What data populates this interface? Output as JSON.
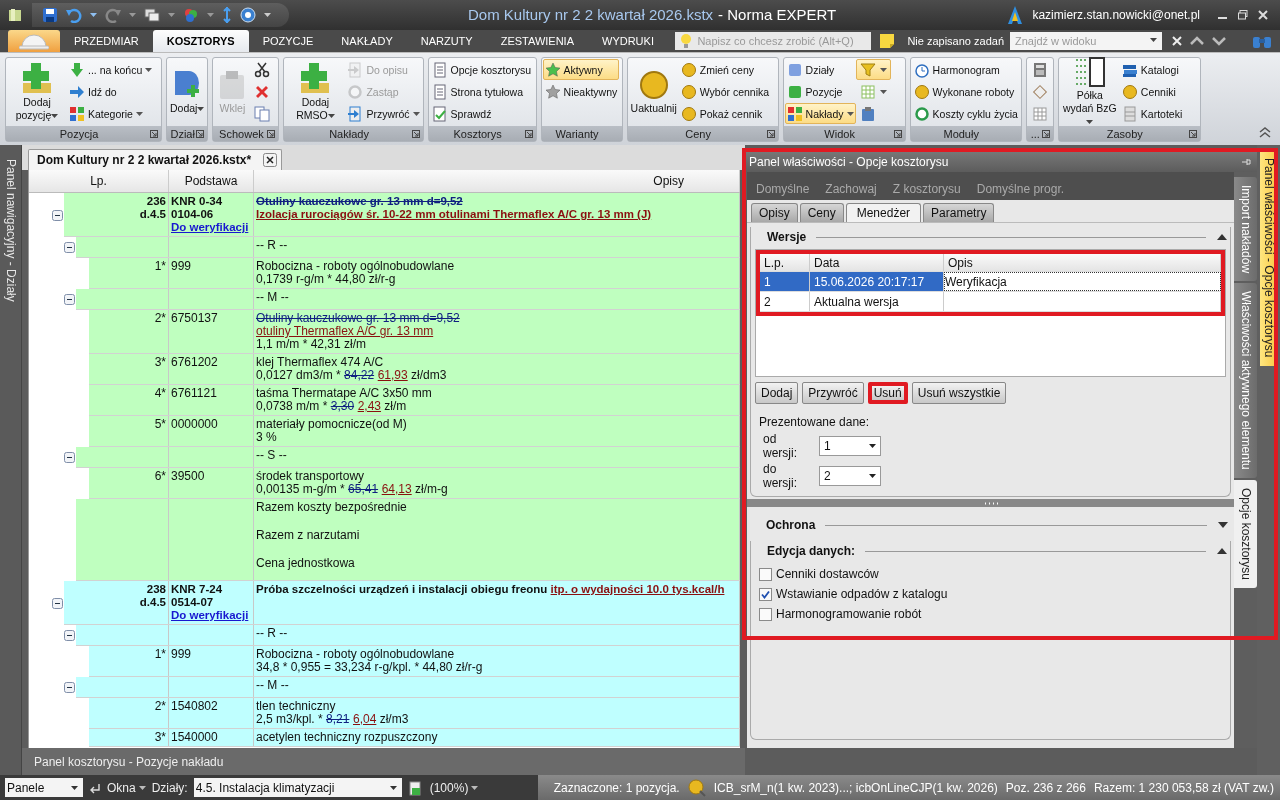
{
  "window": {
    "document": "Dom Kultury nr 2 2 kwartał 2026.kstx",
    "app": "- Norma EXPERT",
    "user": "kazimierz.stan.nowicki@onet.pl"
  },
  "ribbon_tabs": [
    {
      "label": "PRZEDMIAR",
      "selected": false
    },
    {
      "label": "KOSZTORYS",
      "selected": true
    },
    {
      "label": "POZYCJE",
      "selected": false
    },
    {
      "label": "NAKŁADY",
      "selected": false
    },
    {
      "label": "NARZUTY",
      "selected": false
    },
    {
      "label": "ZESTAWIENIA",
      "selected": false
    },
    {
      "label": "WYDRUKI",
      "selected": false
    }
  ],
  "help_field": {
    "placeholder": "Napisz co chcesz zrobić (Alt+Q)"
  },
  "tasks_label": "Nie zapisano zadań",
  "find_field": {
    "placeholder": "Znajdź w widoku"
  },
  "ribbon_groups": [
    {
      "label": "Pozycja",
      "launcher": true,
      "items": [
        {
          "kind": "large",
          "label": "Dodaj pozycję",
          "dropdown": true,
          "disabled": false,
          "selected": false
        },
        {
          "kind": "small",
          "label": "... na końcu",
          "dropdown": true,
          "disabled": false,
          "selected": false
        },
        {
          "kind": "small",
          "label": "Idź do",
          "dropdown": false,
          "disabled": false,
          "selected": false
        },
        {
          "kind": "small",
          "label": "Kategorie",
          "dropdown": true,
          "disabled": false,
          "selected": false
        }
      ]
    },
    {
      "label": "Dział",
      "launcher": true,
      "items": [
        {
          "kind": "large",
          "label": "Dodaj",
          "dropdown": true,
          "disabled": false,
          "selected": false
        }
      ]
    },
    {
      "label": "Schowek",
      "launcher": true,
      "items": [
        {
          "kind": "large",
          "label": "Wklej",
          "dropdown": false,
          "disabled": true,
          "selected": false
        },
        {
          "kind": "icon",
          "dropdown": false,
          "disabled": false,
          "selected": false
        },
        {
          "kind": "icon",
          "dropdown": false,
          "disabled": false,
          "selected": false
        },
        {
          "kind": "icon",
          "dropdown": false,
          "disabled": false,
          "selected": false
        }
      ]
    },
    {
      "label": "Nakłady",
      "launcher": true,
      "items": [
        {
          "kind": "large",
          "label": "Dodaj RMSO",
          "dropdown": true,
          "disabled": false,
          "selected": false
        },
        {
          "kind": "small",
          "label": "Do opisu",
          "dropdown": false,
          "disabled": true,
          "selected": false
        },
        {
          "kind": "small",
          "label": "Zastąp",
          "dropdown": false,
          "disabled": true,
          "selected": false
        },
        {
          "kind": "small",
          "label": "Przywróć",
          "dropdown": true,
          "disabled": false,
          "selected": false
        }
      ]
    },
    {
      "label": "Kosztorys",
      "launcher": true,
      "items": [
        {
          "kind": "small",
          "label": "Opcje kosztorysu",
          "dropdown": false,
          "disabled": false,
          "selected": false
        },
        {
          "kind": "small",
          "label": "Strona tytułowa",
          "dropdown": false,
          "disabled": false,
          "selected": false
        },
        {
          "kind": "small",
          "label": "Sprawdź",
          "dropdown": false,
          "disabled": false,
          "selected": false
        }
      ]
    },
    {
      "label": "Warianty",
      "launcher": false,
      "items": [
        {
          "kind": "small",
          "label": "Aktywny",
          "dropdown": false,
          "disabled": false,
          "selected": true
        },
        {
          "kind": "small",
          "label": "Nieaktywny",
          "dropdown": false,
          "disabled": false,
          "selected": false
        }
      ]
    },
    {
      "label": "Ceny",
      "launcher": true,
      "items": [
        {
          "kind": "large",
          "label": "Uaktualnij",
          "dropdown": false,
          "disabled": false,
          "selected": false
        },
        {
          "kind": "small",
          "label": "Zmień ceny",
          "dropdown": false,
          "disabled": false,
          "selected": false
        },
        {
          "kind": "small",
          "label": "Wybór cennika",
          "dropdown": false,
          "disabled": false,
          "selected": false
        },
        {
          "kind": "small",
          "label": "Pokaż cennik",
          "dropdown": false,
          "disabled": false,
          "selected": false
        }
      ]
    },
    {
      "label": "Widok",
      "launcher": true,
      "items": [
        {
          "kind": "small",
          "label": "Działy",
          "dropdown": false,
          "disabled": false,
          "selected": false
        },
        {
          "kind": "small",
          "label": "Pozycje",
          "dropdown": false,
          "disabled": false,
          "selected": false
        },
        {
          "kind": "small",
          "label": "Nakłady",
          "dropdown": true,
          "disabled": false,
          "selected": true
        },
        {
          "kind": "icon",
          "dropdown": true,
          "disabled": false,
          "selected": true
        },
        {
          "kind": "icon",
          "dropdown": true,
          "disabled": false,
          "selected": false
        },
        {
          "kind": "icon",
          "dropdown": false,
          "disabled": false,
          "selected": false
        }
      ]
    },
    {
      "label": "Moduły",
      "launcher": false,
      "items": [
        {
          "kind": "small",
          "label": "Harmonogram",
          "dropdown": false,
          "disabled": false,
          "selected": false
        },
        {
          "kind": "small",
          "label": "Wykonane roboty",
          "dropdown": false,
          "disabled": false,
          "selected": false
        },
        {
          "kind": "small",
          "label": "Koszty cyklu życia",
          "dropdown": false,
          "disabled": false,
          "selected": false
        }
      ]
    },
    {
      "label": "...",
      "launcher": true,
      "items": [
        {
          "kind": "icon",
          "dropdown": false,
          "disabled": false,
          "selected": false
        },
        {
          "kind": "icon",
          "dropdown": false,
          "disabled": false,
          "selected": false
        },
        {
          "kind": "icon",
          "dropdown": false,
          "disabled": false,
          "selected": false
        }
      ]
    },
    {
      "label": "Zasoby",
      "launcher": true,
      "items": [
        {
          "kind": "large",
          "label": "Półka wydań BzG",
          "dropdown": true,
          "disabled": false,
          "selected": false
        },
        {
          "kind": "small",
          "label": "Katalogi",
          "dropdown": false,
          "disabled": false,
          "selected": false
        },
        {
          "kind": "small",
          "label": "Cenniki",
          "dropdown": false,
          "disabled": false,
          "selected": false
        },
        {
          "kind": "small",
          "label": "Kartoteki",
          "dropdown": false,
          "disabled": false,
          "selected": false
        }
      ]
    }
  ],
  "navigation_tab": "Panel nawigacyjny - Działy",
  "document_tab": "Dom Kultury nr 2 2 kwartał 2026.kstx*",
  "table_columns": [
    "Lp.",
    "Podstawa",
    "Opisy"
  ],
  "positions": [
    {
      "lp": "236",
      "chapter": "d.4.5",
      "basis": [
        "KNR 0-34",
        "0104-06"
      ],
      "status": "Do weryfikacji",
      "color": "#bfffbf",
      "expanded": true,
      "description": [
        [
          {
            "text": "Otuliny kauczukowe gr. 13 mm d=9,52",
            "kind": "old"
          }
        ],
        [
          {
            "text": "Izolacja rurociągów śr. 10-22 mm otulinami Thermaflex A/C gr. 13 mm (J)",
            "kind": "new"
          }
        ]
      ],
      "groups": [
        {
          "label": "-- R --",
          "expanded": true,
          "resources": [
            {
              "lp": "1*",
              "code": "999",
              "lines": [
                [
                  {
                    "text": "Robocizna - roboty ogólnobudowlane",
                    "kind": "plain"
                  }
                ],
                [
                  {
                    "text": "0,1739 r-g/m * 44,80 zł/r-g",
                    "kind": "plain"
                  }
                ]
              ]
            }
          ]
        },
        {
          "label": "-- M --",
          "expanded": true,
          "resources": [
            {
              "lp": "2*",
              "code": "6750137",
              "lines": [
                [
                  {
                    "text": "Otuliny kauczukowe gr. 13 mm d=9,52",
                    "kind": "old"
                  }
                ],
                [
                  {
                    "text": "otuliny Thermaflex A/C gr. 13 mm",
                    "kind": "new"
                  }
                ],
                [
                  {
                    "text": "1,1 m/m * 42,31 zł/m",
                    "kind": "plain"
                  }
                ]
              ]
            },
            {
              "lp": "3*",
              "code": "6761202",
              "lines": [
                [
                  {
                    "text": "klej Thermaflex 474 A/C",
                    "kind": "plain"
                  }
                ],
                [
                  {
                    "text": "0,0127 dm3/m * ",
                    "kind": "plain"
                  },
                  {
                    "text": "84,22",
                    "kind": "old"
                  },
                  {
                    "text": "61,93",
                    "kind": "new"
                  },
                  {
                    "text": " zł/dm3",
                    "kind": "plain"
                  }
                ]
              ]
            },
            {
              "lp": "4*",
              "code": "6761121",
              "lines": [
                [
                  {
                    "text": "taśma Thermatape A/C 3x50 mm",
                    "kind": "plain"
                  }
                ],
                [
                  {
                    "text": "0,0738 m/m * ",
                    "kind": "plain"
                  },
                  {
                    "text": "3,30",
                    "kind": "old"
                  },
                  {
                    "text": "2,43",
                    "kind": "new"
                  },
                  {
                    "text": " zł/m",
                    "kind": "plain"
                  }
                ]
              ]
            },
            {
              "lp": "5*",
              "code": "0000000",
              "lines": [
                [
                  {
                    "text": "materiały pomocnicze(od M)",
                    "kind": "plain"
                  }
                ],
                [
                  {
                    "text": "3 %",
                    "kind": "plain"
                  }
                ]
              ]
            }
          ]
        },
        {
          "label": "-- S --",
          "expanded": true,
          "resources": [
            {
              "lp": "6*",
              "code": "39500",
              "lines": [
                [
                  {
                    "text": "środek transportowy",
                    "kind": "plain"
                  }
                ],
                [
                  {
                    "text": "0,00135 m-g/m * ",
                    "kind": "plain"
                  },
                  {
                    "text": "65,41",
                    "kind": "old"
                  },
                  {
                    "text": "64,13",
                    "kind": "new"
                  },
                  {
                    "text": " zł/m-g",
                    "kind": "plain"
                  }
                ]
              ]
            }
          ]
        }
      ],
      "summary": [
        "Razem koszty bezpośrednie",
        "Razem z narzutami",
        "Cena jednostkowa"
      ]
    },
    {
      "lp": "238",
      "chapter": "d.4.5",
      "basis": [
        "KNR 7-24",
        "0514-07"
      ],
      "status": "Do weryfikacji",
      "color": "#bfffff",
      "expanded": true,
      "description": [
        [
          {
            "text": "Próba szczelności urządzeń i instalacji obiegu freonu ",
            "kind": "plain"
          },
          {
            "text": "itp. o wydajności 10.0 tys.kcal/h",
            "kind": "new"
          }
        ]
      ],
      "groups": [
        {
          "label": "-- R --",
          "expanded": true,
          "resources": [
            {
              "lp": "1*",
              "code": "999",
              "lines": [
                [
                  {
                    "text": "Robocizna - roboty ogólnobudowlane",
                    "kind": "plain"
                  }
                ],
                [
                  {
                    "text": "34,8 * 0,955 = 33,234 r-g/kpl. * 44,80 zł/r-g",
                    "kind": "plain"
                  }
                ]
              ]
            }
          ]
        },
        {
          "label": "-- M --",
          "expanded": true,
          "resources": [
            {
              "lp": "2*",
              "code": "1540802",
              "lines": [
                [
                  {
                    "text": "tlen techniczny",
                    "kind": "plain"
                  }
                ],
                [
                  {
                    "text": "2,5 m3/kpl. * ",
                    "kind": "plain"
                  },
                  {
                    "text": "8,21",
                    "kind": "old"
                  },
                  {
                    "text": "6,04",
                    "kind": "new"
                  },
                  {
                    "text": " zł/m3",
                    "kind": "plain"
                  }
                ]
              ]
            },
            {
              "lp": "3*",
              "code": "1540000",
              "lines": [
                [
                  {
                    "text": "acetylen techniczny rozpuszczony",
                    "kind": "plain"
                  }
                ]
              ]
            }
          ]
        }
      ]
    }
  ],
  "bottom_panel_tab": "Panel kosztorysu - Pozycje nakładu",
  "property_panel": {
    "title": "Panel właściwości - Opcje kosztorysu",
    "highlighted": true,
    "toolbar": [
      {
        "label": "Domyślne",
        "disabled": true
      },
      {
        "label": "Zachowaj",
        "disabled": true
      },
      {
        "label": "Z kosztorysu",
        "disabled": true
      },
      {
        "label": "Domyślne progr.",
        "disabled": true
      }
    ],
    "tabs": [
      {
        "label": "Opisy",
        "selected": false
      },
      {
        "label": "Ceny",
        "selected": false
      },
      {
        "label": "Menedżer",
        "selected": true
      },
      {
        "label": "Parametry",
        "selected": false
      }
    ],
    "versions": {
      "title": "Wersje",
      "expanded": true,
      "highlighted": true,
      "columns": [
        "L.p.",
        "Data",
        "Opis"
      ],
      "rows": [
        {
          "cells": [
            "1",
            "15.06.2026 20:17:17",
            "Weryfikacja"
          ],
          "selected": true
        },
        {
          "cells": [
            "2",
            "Aktualna wersja"
          ],
          "selected": false
        }
      ]
    },
    "buttons": [
      {
        "label": "Dodaj",
        "highlighted": false
      },
      {
        "label": "Przywróć",
        "highlighted": false
      },
      {
        "label": "Usuń",
        "highlighted": true
      },
      {
        "label": "Usuń wszystkie",
        "highlighted": false
      }
    ],
    "presented_label": "Prezentowane dane:",
    "range": [
      {
        "label": "od wersji:",
        "value": "1"
      },
      {
        "label": "do wersji:",
        "value": "2"
      }
    ],
    "sections": [
      {
        "title": "Ochrona",
        "expanded": false
      },
      {
        "title": "Edycja danych:",
        "expanded": true,
        "options": [
          {
            "label": "Cenniki dostawców",
            "checked": false
          },
          {
            "label": "Wstawianie odpadów z katalogu",
            "checked": true
          },
          {
            "label": "Harmonogramowanie robót",
            "checked": false
          }
        ]
      }
    ]
  },
  "side_tabs": [
    {
      "label": "Import nakładów",
      "selected": false
    },
    {
      "label": "Właściwości aktywnego elementu",
      "selected": false
    },
    {
      "label": "Opcje kosztorysu",
      "selected": true
    }
  ],
  "pinned_tab": "Panel właściwości - Opcje kosztorysu",
  "status_bar": {
    "panels": "Panele",
    "windows": "Okna",
    "sections_label": "Działy:",
    "section": "4.5. Instalacja klimatyzacji",
    "zoom": "(100%)",
    "selection": "Zaznaczone: 1 pozycja.",
    "price_lists": "ICB_srM_n(1 kw. 2023)...; icbOnLineCJP(1 kw. 2026)",
    "position": "Poz. 236 z 266",
    "total": "Razem: 1 230 053,58 zł (VAT zw.)"
  }
}
